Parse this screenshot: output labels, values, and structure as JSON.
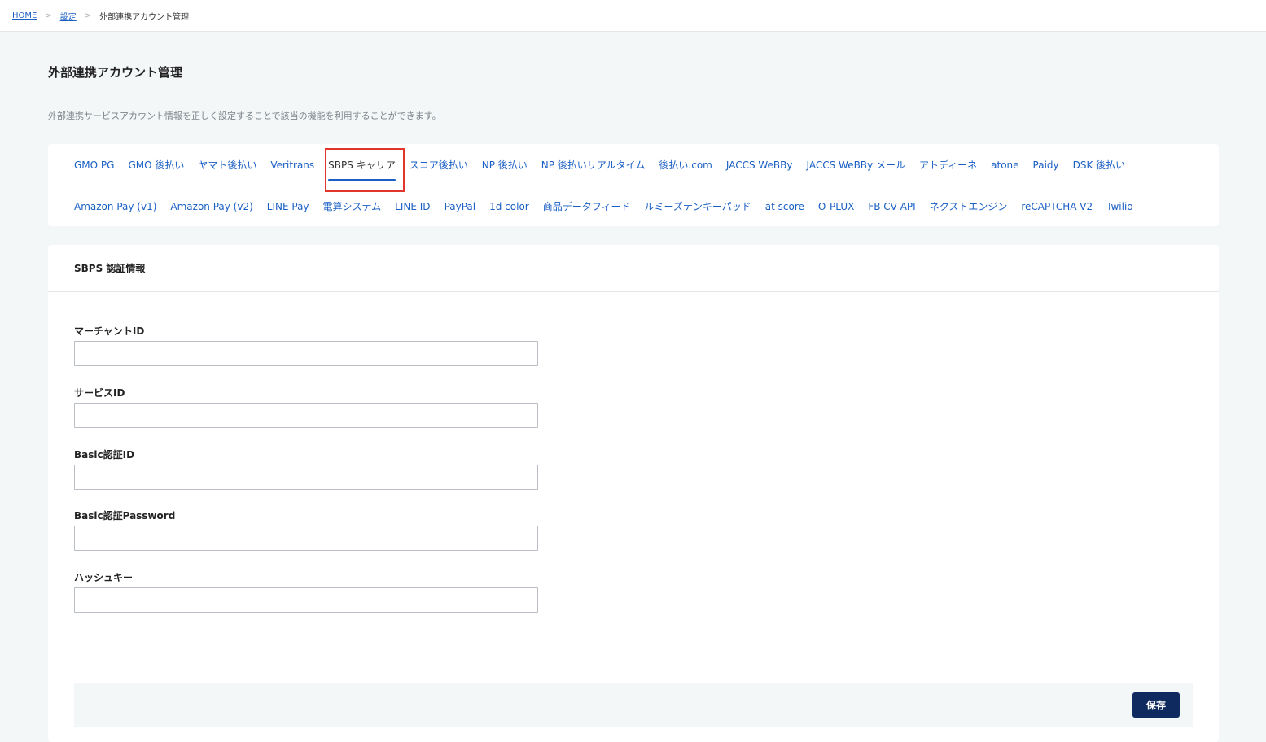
{
  "breadcrumb": {
    "home": "HOME",
    "settings": "設定",
    "separator": ">",
    "current": "外部連携アカウント管理"
  },
  "page": {
    "title": "外部連携アカウント管理",
    "description": "外部連携サービスアカウント情報を正しく設定することで該当の機能を利用することができます。"
  },
  "tabs": {
    "row1": [
      "GMO PG",
      "GMO 後払い",
      "ヤマト後払い",
      "Veritrans",
      "SBPS キャリア",
      "スコア後払い",
      "NP 後払い",
      "NP 後払いリアルタイム",
      "後払い.com",
      "JACCS WeBBy",
      "JACCS WeBBy メール",
      "アトディーネ",
      "atone",
      "Paidy",
      "DSK 後払い"
    ],
    "row2": [
      "Amazon Pay (v1)",
      "Amazon Pay (v2)",
      "LINE Pay",
      "電算システム",
      "LINE ID",
      "PayPal",
      "1d color",
      "商品データフィード",
      "ルミーズテンキーパッド",
      "at score",
      "O-PLUX",
      "FB CV API",
      "ネクストエンジン",
      "reCAPTCHA V2",
      "Twilio"
    ],
    "active": "SBPS キャリア"
  },
  "form": {
    "section_title": "SBPS 認証情報",
    "fields": [
      {
        "label": "マーチャントID",
        "value": "",
        "placeholder": ""
      },
      {
        "label": "サービスID",
        "value": "",
        "placeholder": ""
      },
      {
        "label": "Basic認証ID",
        "value": "",
        "placeholder": ""
      },
      {
        "label": "Basic認証Password",
        "value": "",
        "placeholder": ""
      },
      {
        "label": "ハッシュキー",
        "value": "",
        "placeholder": ""
      }
    ],
    "save_label": "保存"
  },
  "colors": {
    "link": "#1a5fc4",
    "highlight": "#e0362c",
    "save_button": "#0f2a5e"
  }
}
